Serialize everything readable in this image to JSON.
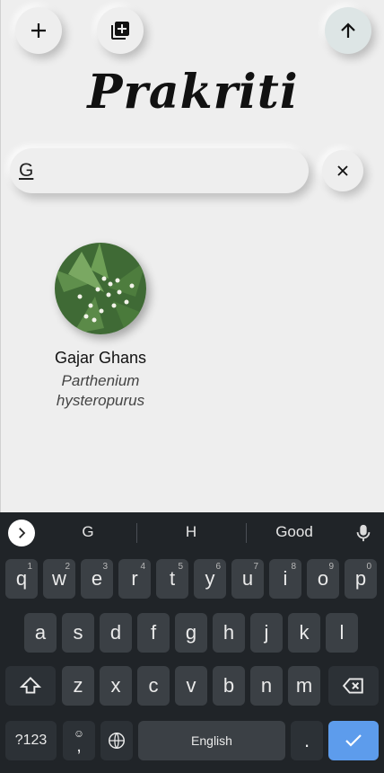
{
  "app": {
    "title": "Prakriti",
    "search": {
      "value": "G",
      "placeholder": ""
    },
    "results": [
      {
        "common_name": "Gajar Ghans",
        "scientific_name": "Parthenium hysteropurus"
      }
    ]
  },
  "keyboard": {
    "suggestions": [
      "G",
      "H",
      "Good"
    ],
    "row1": [
      {
        "k": "q",
        "n": "1"
      },
      {
        "k": "w",
        "n": "2"
      },
      {
        "k": "e",
        "n": "3"
      },
      {
        "k": "r",
        "n": "4"
      },
      {
        "k": "t",
        "n": "5"
      },
      {
        "k": "y",
        "n": "6"
      },
      {
        "k": "u",
        "n": "7"
      },
      {
        "k": "i",
        "n": "8"
      },
      {
        "k": "o",
        "n": "9"
      },
      {
        "k": "p",
        "n": "0"
      }
    ],
    "row2": [
      "a",
      "s",
      "d",
      "f",
      "g",
      "h",
      "j",
      "k",
      "l"
    ],
    "row3": [
      "z",
      "x",
      "c",
      "v",
      "b",
      "n",
      "m"
    ],
    "symbols_label": "?123",
    "comma": ",",
    "space_label": "English",
    "period": "."
  },
  "colors": {
    "background": "#eeeeee",
    "keyboard": "#202428",
    "key": "#3b4045",
    "enter": "#5d9cec"
  }
}
